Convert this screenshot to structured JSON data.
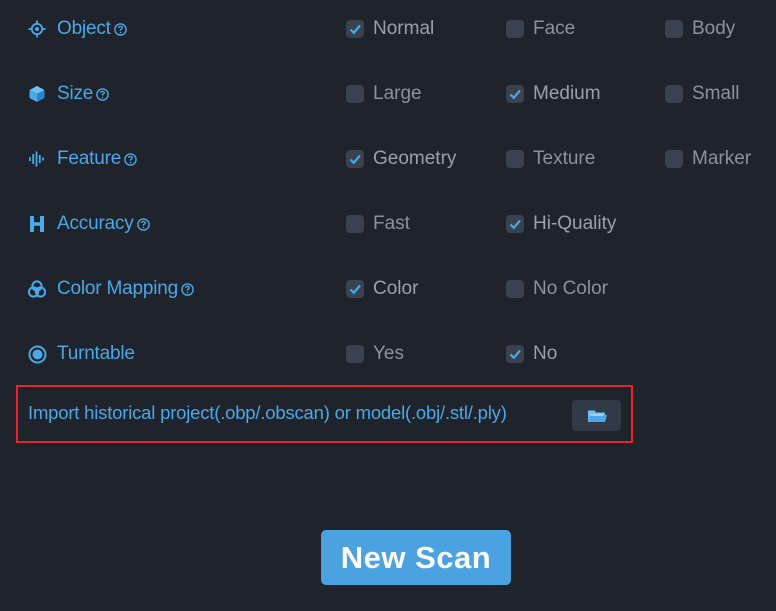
{
  "settings": {
    "rows": [
      {
        "label": "Object",
        "icon": "crosshair-icon",
        "has_help": true,
        "options": [
          {
            "label": "Normal",
            "checked": true
          },
          {
            "label": "Face",
            "checked": false
          },
          {
            "label": "Body",
            "checked": false
          }
        ]
      },
      {
        "label": "Size",
        "icon": "cube-icon",
        "has_help": true,
        "options": [
          {
            "label": "Large",
            "checked": false
          },
          {
            "label": "Medium",
            "checked": true
          },
          {
            "label": "Small",
            "checked": false
          }
        ]
      },
      {
        "label": "Feature",
        "icon": "waveform-icon",
        "has_help": true,
        "options": [
          {
            "label": "Geometry",
            "checked": true
          },
          {
            "label": "Texture",
            "checked": false
          },
          {
            "label": "Marker",
            "checked": false
          }
        ]
      },
      {
        "label": "Accuracy",
        "icon": "h-letter-icon",
        "has_help": true,
        "options": [
          {
            "label": "Fast",
            "checked": false
          },
          {
            "label": "Hi-Quality",
            "checked": true
          }
        ]
      },
      {
        "label": "Color Mapping",
        "icon": "color-circles-icon",
        "has_help": true,
        "options": [
          {
            "label": "Color",
            "checked": true
          },
          {
            "label": "No Color",
            "checked": false
          }
        ]
      },
      {
        "label": "Turntable",
        "icon": "turntable-icon",
        "has_help": false,
        "options": [
          {
            "label": "Yes",
            "checked": false
          },
          {
            "label": "No",
            "checked": true
          }
        ]
      }
    ]
  },
  "import": {
    "text": "Import historical project(.obp/.obscan) or model(.obj/.stl/.ply)",
    "button_icon": "folder-open-icon"
  },
  "new_scan": {
    "label": "New Scan"
  },
  "colors": {
    "accent": "#4aa9e6",
    "background": "#1e232c",
    "checkbox": "#3a4250",
    "highlight_border": "#e0252b",
    "button": "#4aa3e0"
  }
}
